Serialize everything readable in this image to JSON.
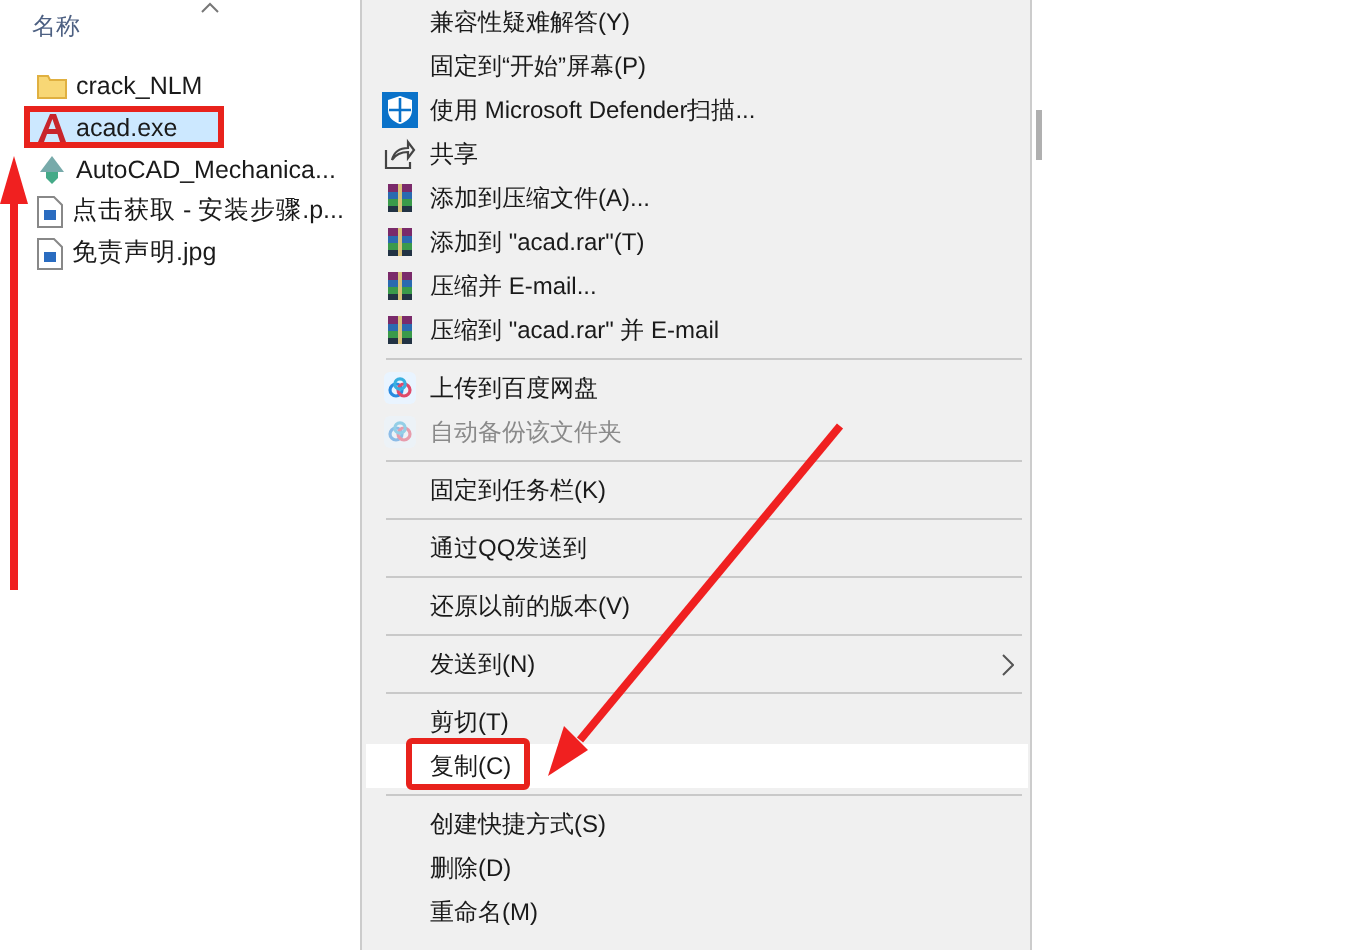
{
  "file_list": {
    "column_header": "名称",
    "files": [
      {
        "name": "crack_NLM",
        "kind": "folder",
        "selected": false,
        "highlighted": false
      },
      {
        "name": "acad.exe",
        "kind": "app",
        "selected": true,
        "highlighted": true
      },
      {
        "name": "AutoCAD_Mechanica...",
        "kind": "installer",
        "selected": false,
        "highlighted": false
      },
      {
        "name": "点击获取 - 安装步骤.p...",
        "kind": "image",
        "selected": false,
        "highlighted": false
      },
      {
        "name": "免责声明.jpg",
        "kind": "image",
        "selected": false,
        "highlighted": false
      }
    ]
  },
  "context_menu": {
    "items": [
      {
        "kind": "plain",
        "label": "兼容性疑难解答(Y)",
        "disabled": false,
        "submenu": false,
        "selected": false,
        "highlighted": false
      },
      {
        "kind": "plain",
        "label": "固定到“开始”屏幕(P)",
        "disabled": false,
        "submenu": false,
        "selected": false,
        "highlighted": false
      },
      {
        "kind": "shield",
        "label": "使用 Microsoft Defender扫描...",
        "disabled": false,
        "submenu": false,
        "selected": false,
        "highlighted": false
      },
      {
        "kind": "share",
        "label": "共享",
        "disabled": false,
        "submenu": false,
        "selected": false,
        "highlighted": false
      },
      {
        "kind": "archive",
        "label": "添加到压缩文件(A)...",
        "disabled": false,
        "submenu": false,
        "selected": false,
        "highlighted": false
      },
      {
        "kind": "archive",
        "label": "添加到 \"acad.rar\"(T)",
        "disabled": false,
        "submenu": false,
        "selected": false,
        "highlighted": false
      },
      {
        "kind": "archive",
        "label": "压缩并 E-mail...",
        "disabled": false,
        "submenu": false,
        "selected": false,
        "highlighted": false
      },
      {
        "kind": "archive",
        "label": "压缩到 \"acad.rar\" 并 E-mail",
        "disabled": false,
        "submenu": false,
        "selected": false,
        "highlighted": false
      },
      {
        "kind": "separator"
      },
      {
        "kind": "cloud",
        "label": "上传到百度网盘",
        "disabled": false,
        "submenu": false,
        "selected": false,
        "highlighted": false
      },
      {
        "kind": "cloud",
        "label": "自动备份该文件夹",
        "disabled": true,
        "submenu": false,
        "selected": false,
        "highlighted": false
      },
      {
        "kind": "separator"
      },
      {
        "kind": "plain",
        "label": "固定到任务栏(K)",
        "disabled": false,
        "submenu": false,
        "selected": false,
        "highlighted": false
      },
      {
        "kind": "separator"
      },
      {
        "kind": "plain",
        "label": "通过QQ发送到",
        "disabled": false,
        "submenu": false,
        "selected": false,
        "highlighted": false
      },
      {
        "kind": "separator"
      },
      {
        "kind": "plain",
        "label": "还原以前的版本(V)",
        "disabled": false,
        "submenu": false,
        "selected": false,
        "highlighted": false
      },
      {
        "kind": "separator"
      },
      {
        "kind": "plain",
        "label": "发送到(N)",
        "disabled": false,
        "submenu": true,
        "selected": false,
        "highlighted": false
      },
      {
        "kind": "separator"
      },
      {
        "kind": "plain",
        "label": "剪切(T)",
        "disabled": false,
        "submenu": false,
        "selected": false,
        "highlighted": false
      },
      {
        "kind": "plain",
        "label": "复制(C)",
        "disabled": false,
        "submenu": false,
        "selected": true,
        "highlighted": true
      },
      {
        "kind": "separator"
      },
      {
        "kind": "plain",
        "label": "创建快捷方式(S)",
        "disabled": false,
        "submenu": false,
        "selected": false,
        "highlighted": false
      },
      {
        "kind": "plain",
        "label": "删除(D)",
        "disabled": false,
        "submenu": false,
        "selected": false,
        "highlighted": false
      },
      {
        "kind": "plain",
        "label": "重命名(M)",
        "disabled": false,
        "submenu": false,
        "selected": false,
        "highlighted": false
      }
    ]
  }
}
